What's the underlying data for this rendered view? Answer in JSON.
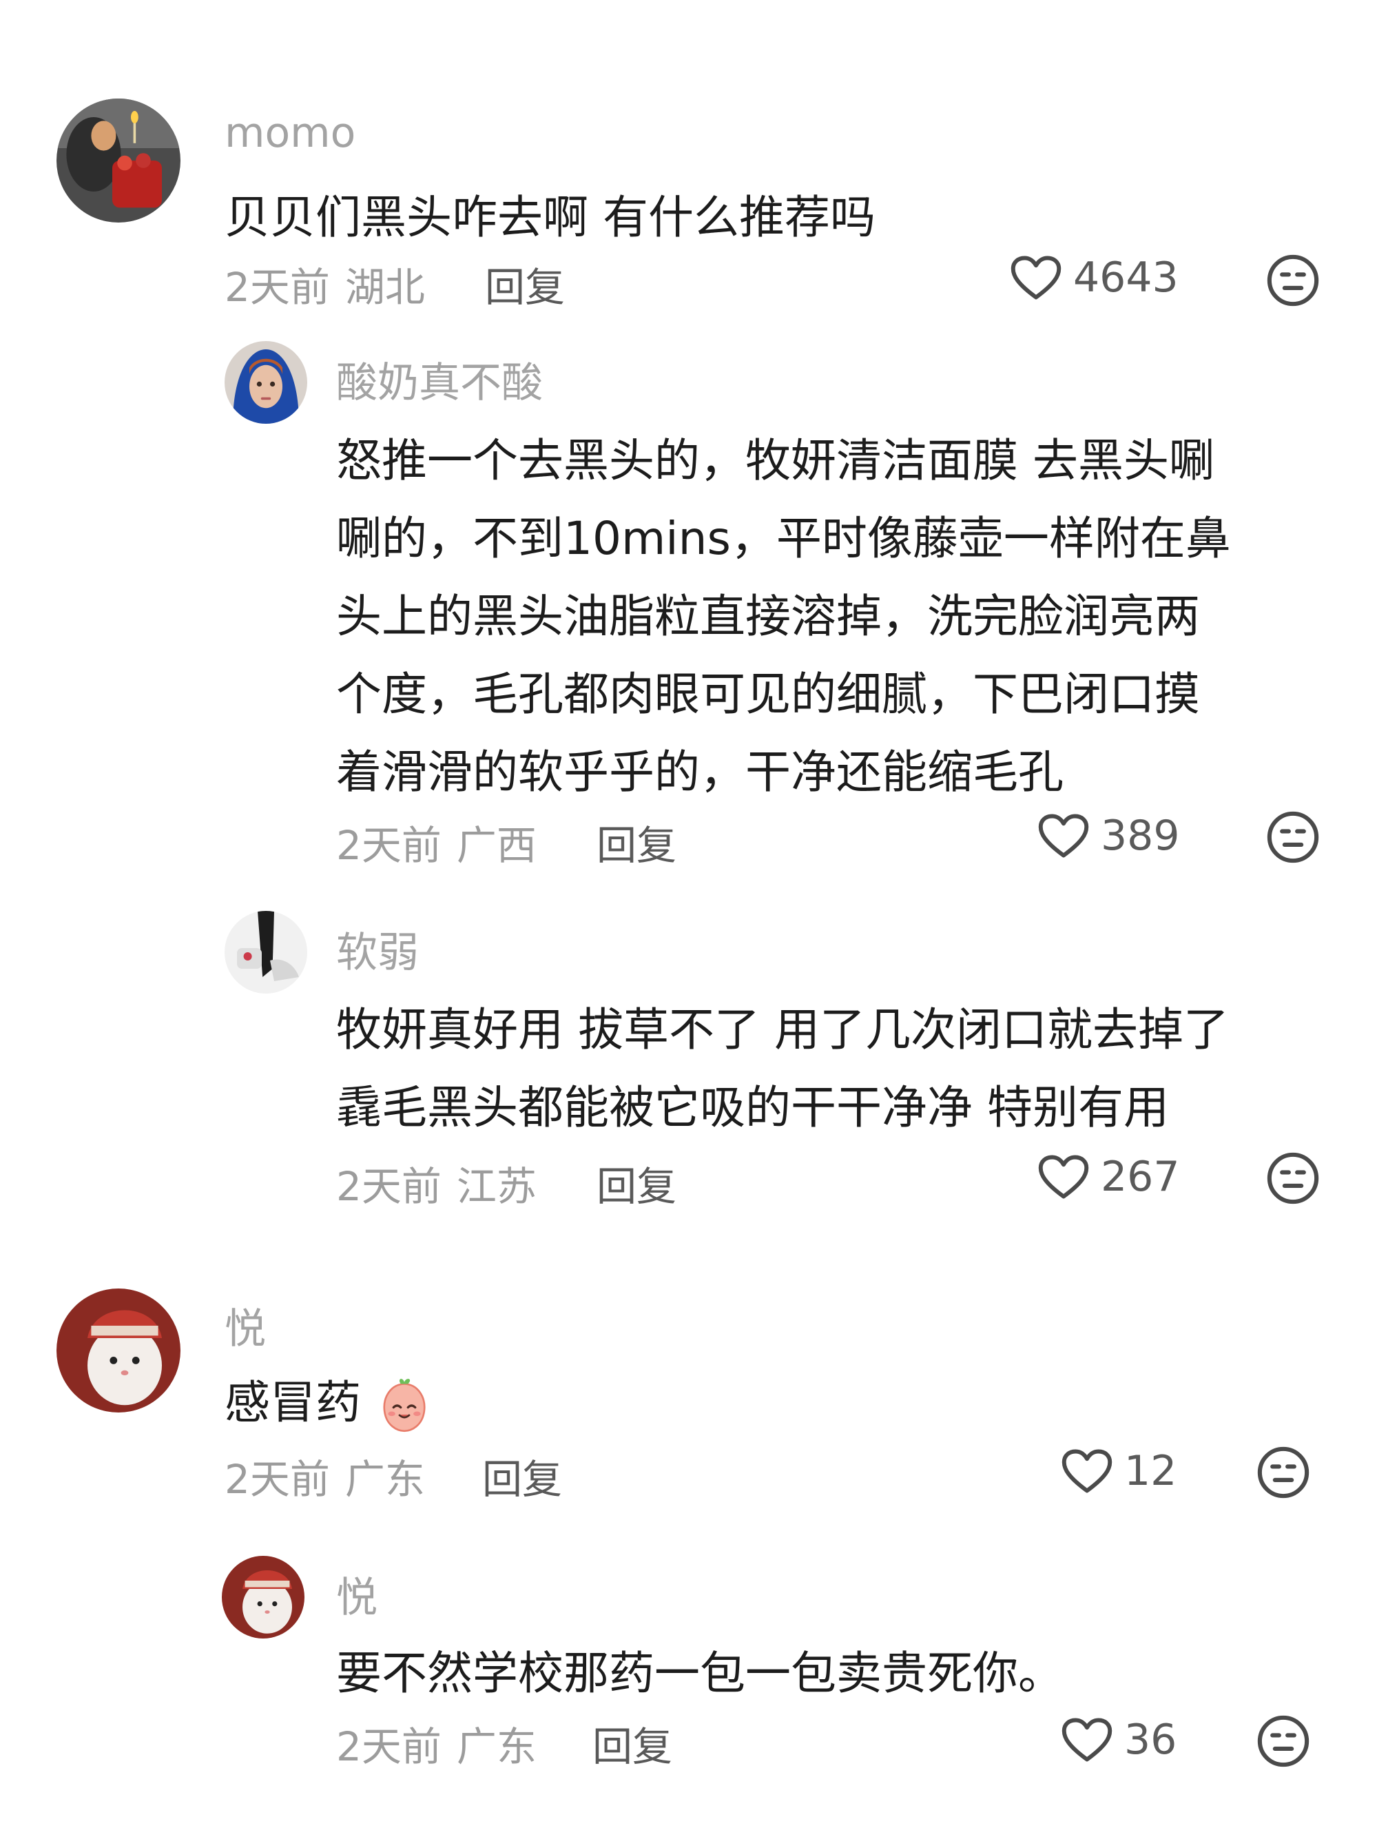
{
  "comments": [
    {
      "user": "momo",
      "lines": [
        "贝贝们黑头咋去啊 有什么推荐吗"
      ],
      "time": "2天前",
      "location": "湖北",
      "reply": "回复",
      "likes": "4643",
      "icon_like": "heart-outline-icon",
      "icon_dislike": "meh-face-icon"
    },
    {
      "user": "酸奶真不酸",
      "lines": [
        "怒推一个去黑头的，牧妍清洁面膜 去黑头唰",
        "唰的，不到10mins，平时像藤壶一样附在鼻",
        "头上的黑头油脂粒直接溶掉，洗完脸润亮两",
        "个度，毛孔都肉眼可见的细腻，下巴闭口摸",
        "着滑滑的软乎乎的，干净还能缩毛孔"
      ],
      "time": "2天前",
      "location": "广西",
      "reply": "回复",
      "likes": "389"
    },
    {
      "user": "软弱",
      "lines": [
        "牧妍真好用 拔草不了 用了几次闭口就去掉了",
        "毳毛黑头都能被它吸的干干净净 特别有用"
      ],
      "time": "2天前",
      "location": "江苏",
      "reply": "回复",
      "likes": "267"
    },
    {
      "user": "悦",
      "lines": [
        "感冒药"
      ],
      "emoji": "peach-smile-emoji",
      "time": "2天前",
      "location": "广东",
      "reply": "回复",
      "likes": "12"
    },
    {
      "user": "悦",
      "lines": [
        "要不然学校那药一包一包卖贵死你。"
      ],
      "time": "2天前",
      "location": "广东",
      "reply": "回复",
      "likes": "36"
    }
  ],
  "colors": {
    "username": "#a3a3a3",
    "text": "#1c1c1c",
    "meta": "#9c9c9c",
    "icon": "#4a4a4a"
  }
}
